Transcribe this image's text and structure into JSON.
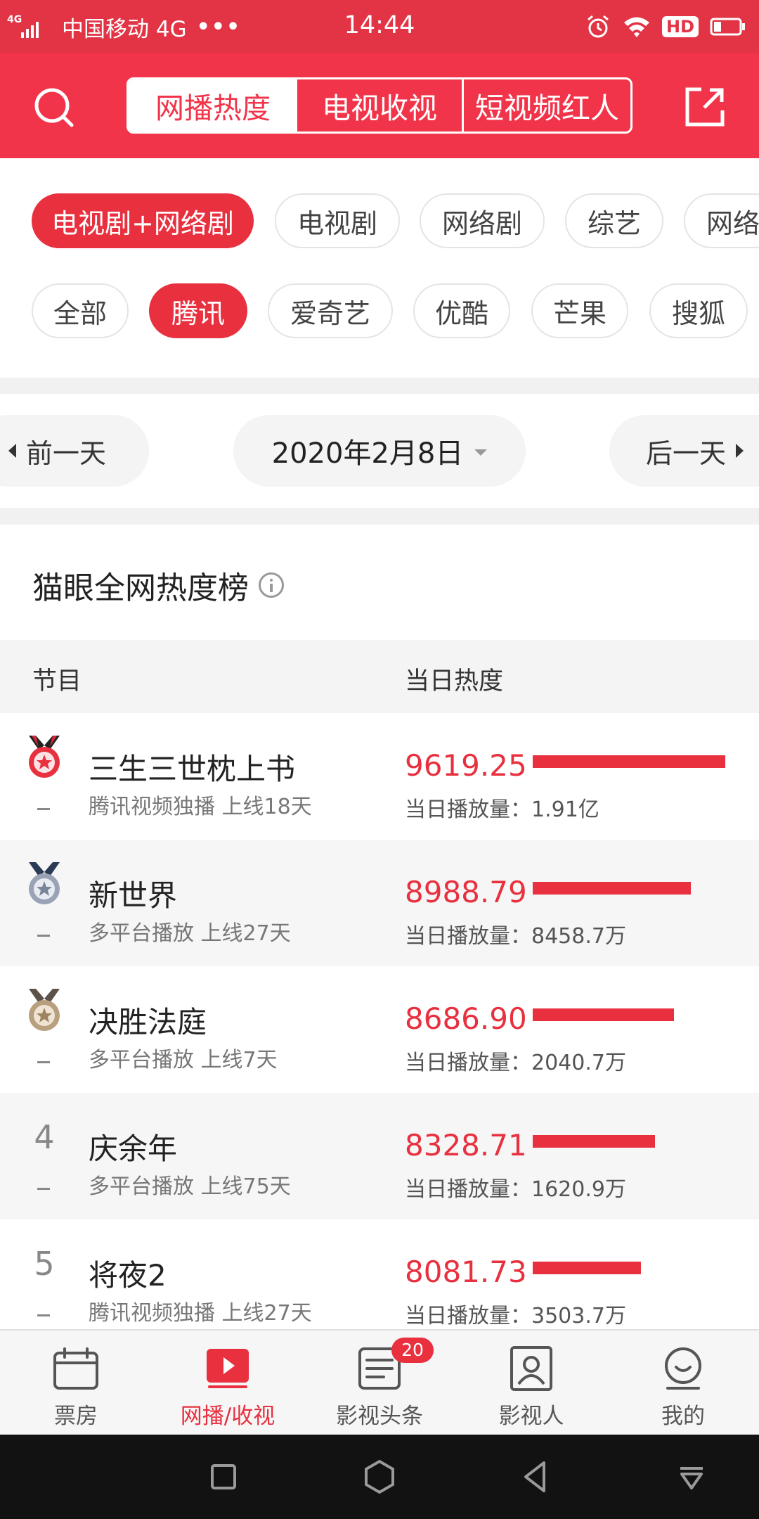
{
  "status_bar": {
    "network_type": "4G",
    "carrier": "中国移动 4G",
    "more": "•••",
    "time": "14:44",
    "hd_label": "HD"
  },
  "header": {
    "tabs": [
      {
        "label": "网播热度",
        "active": true
      },
      {
        "label": "电视收视",
        "active": false
      },
      {
        "label": "短视频红人",
        "active": false
      }
    ],
    "icons": {
      "search": "search-icon",
      "share": "share-icon"
    }
  },
  "filters": {
    "categories": [
      {
        "label": "电视剧+网络剧",
        "active": true
      },
      {
        "label": "电视剧",
        "active": false
      },
      {
        "label": "网络剧",
        "active": false
      },
      {
        "label": "综艺",
        "active": false
      },
      {
        "label": "网络",
        "active": false
      }
    ],
    "platforms": [
      {
        "label": "全部",
        "active": false
      },
      {
        "label": "腾讯",
        "active": true
      },
      {
        "label": "爱奇艺",
        "active": false
      },
      {
        "label": "优酷",
        "active": false
      },
      {
        "label": "芒果",
        "active": false
      },
      {
        "label": "搜狐",
        "active": false
      }
    ]
  },
  "date_nav": {
    "prev_label": "前一天",
    "date": "2020年2月8日",
    "next_label": "后一天"
  },
  "ranking": {
    "title": "猫眼全网热度榜",
    "col_program": "节目",
    "col_heat": "当日热度",
    "rows": [
      {
        "rank": "1",
        "medal": "gold-medal-icon",
        "title": "三生三世枕上书",
        "meta": "腾讯视频独播  上线18天",
        "heat": "9619.25",
        "heat_value": 9619.25,
        "plays": "当日播放量：1.91亿"
      },
      {
        "rank": "2",
        "medal": "silver-medal-icon",
        "title": "新世界",
        "meta": "多平台播放  上线27天",
        "heat": "8988.79",
        "heat_value": 8988.79,
        "plays": "当日播放量：8458.7万"
      },
      {
        "rank": "3",
        "medal": "bronze-medal-icon",
        "title": "决胜法庭",
        "meta": "多平台播放  上线7天",
        "heat": "8686.90",
        "heat_value": 8686.9,
        "plays": "当日播放量：2040.7万"
      },
      {
        "rank": "4",
        "medal": "",
        "title": "庆余年",
        "meta": "多平台播放  上线75天",
        "heat": "8328.71",
        "heat_value": 8328.71,
        "plays": "当日播放量：1620.9万"
      },
      {
        "rank": "5",
        "medal": "",
        "title": "将夜2",
        "meta": "腾讯视频独播  上线27天",
        "heat": "8081.73",
        "heat_value": 8081.73,
        "plays": "当日播放量：3503.7万"
      }
    ]
  },
  "bottom_nav": {
    "items": [
      {
        "label": "票房",
        "icon": "calendar-icon",
        "active": false
      },
      {
        "label": "网播/收视",
        "icon": "play-icon",
        "active": true
      },
      {
        "label": "影视头条",
        "icon": "news-icon",
        "active": false,
        "badge": "20"
      },
      {
        "label": "影视人",
        "icon": "person-card-icon",
        "active": false
      },
      {
        "label": "我的",
        "icon": "profile-icon",
        "active": false
      }
    ]
  },
  "colors": {
    "brand_red": "#f2344a",
    "accent_red": "#e8303f",
    "status_bar": "#e23445"
  }
}
